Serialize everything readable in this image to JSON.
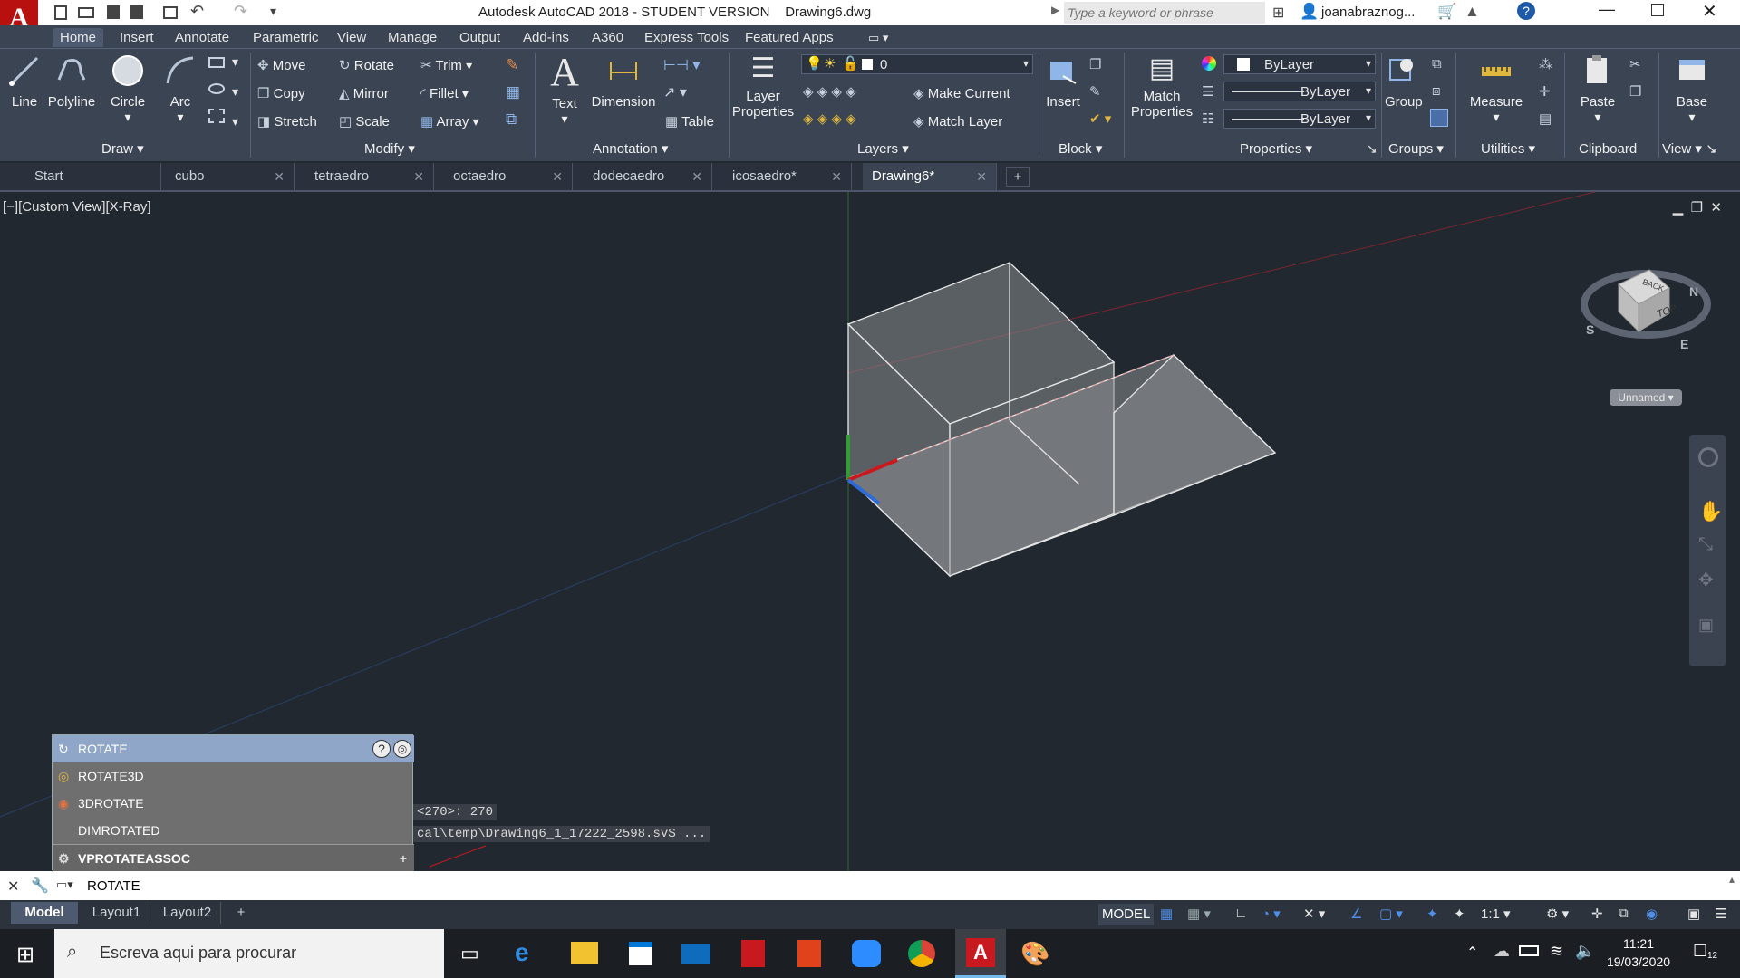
{
  "window": {
    "app_title": "Autodesk AutoCAD 2018 - STUDENT VERSION",
    "file_title": "Drawing6.dwg",
    "search_placeholder": "Type a keyword or phrase",
    "user": "joanabraznog...",
    "logo_letter": "A"
  },
  "ribbon_tabs": [
    "Home",
    "Insert",
    "Annotate",
    "Parametric",
    "View",
    "Manage",
    "Output",
    "Add-ins",
    "A360",
    "Express Tools",
    "Featured Apps"
  ],
  "draw": {
    "line": "Line",
    "polyline": "Polyline",
    "circle": "Circle",
    "arc": "Arc",
    "title": "Draw"
  },
  "modify": {
    "move": "Move",
    "rotate": "Rotate",
    "trim": "Trim",
    "copy": "Copy",
    "mirror": "Mirror",
    "fillet": "Fillet",
    "stretch": "Stretch",
    "scale": "Scale",
    "array": "Array",
    "title": "Modify"
  },
  "annotation": {
    "text": "Text",
    "dimension": "Dimension",
    "table": "Table",
    "title": "Annotation"
  },
  "layers": {
    "layer_properties_1": "Layer",
    "layer_properties_2": "Properties",
    "current_layer": "0",
    "make_current": "Make Current",
    "match_layer": "Match Layer",
    "title": "Layers"
  },
  "block": {
    "insert": "Insert",
    "title": "Block"
  },
  "properties": {
    "match_1": "Match",
    "match_2": "Properties",
    "color": "ByLayer",
    "linetype": "ByLayer",
    "lineweight": "ByLayer",
    "title": "Properties"
  },
  "groups": {
    "group": "Group",
    "title": "Groups"
  },
  "utilities": {
    "measure": "Measure",
    "title": "Utilities"
  },
  "clipboard": {
    "paste": "Paste",
    "title": "Clipboard"
  },
  "view": {
    "base": "Base",
    "title": "View"
  },
  "file_tabs": [
    "Start",
    "cubo",
    "tetraedro",
    "octaedro",
    "dodecaedro",
    "icosaedro*",
    "Drawing6*"
  ],
  "viewport": {
    "label": "[−][Custom View][X-Ray]",
    "viewcube_top": "TOP",
    "viewcube_back": "BACK",
    "compass_n": "N",
    "compass_s": "S",
    "compass_e": "E",
    "ucs_label": "Unnamed"
  },
  "autocomplete": {
    "items": [
      "ROTATE",
      "ROTATE3D",
      "3DROTATE",
      "DIMROTATED",
      "VPROTATEASSOC"
    ]
  },
  "history": {
    "line1": "<270>: 270",
    "line2": "cal\\temp\\Drawing6_1_17222_2598.sv$ ..."
  },
  "command": {
    "value": "ROTATE"
  },
  "layout_tabs": [
    "Model",
    "Layout1",
    "Layout2"
  ],
  "status": {
    "model": "MODEL",
    "scale": "1:1"
  },
  "taskbar": {
    "search_placeholder": "Escreva aqui para procurar",
    "time": "11:21",
    "date": "19/03/2020",
    "notifications": "12"
  },
  "colors": {
    "accent": "#3b4453",
    "viewport": "#212830",
    "axis_x": "#c8191e",
    "axis_y": "#2fa02f",
    "axis_z": "#2e6bd6"
  }
}
